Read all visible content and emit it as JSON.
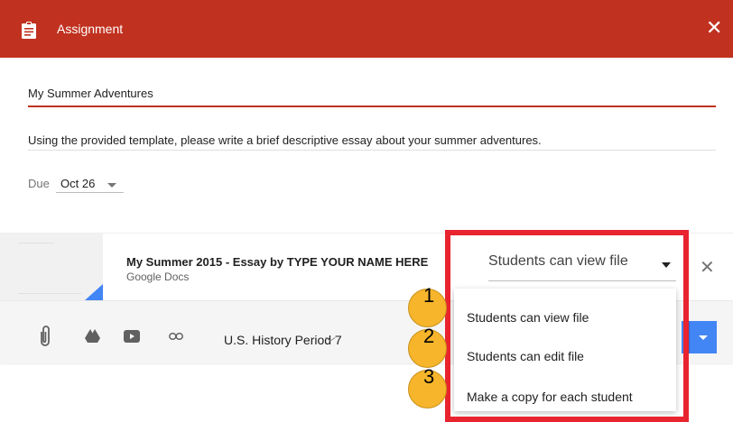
{
  "header": {
    "title": "Assignment",
    "icon": "assignment-icon",
    "close_icon": "close-icon",
    "color": "#c1311f"
  },
  "assignment": {
    "title_value": "My Summer Adventures",
    "instructions_value": "Using the provided template, please write a brief descriptive essay about your summer adventures.",
    "due_label": "Due",
    "due_value": "Oct 26"
  },
  "attachment": {
    "file_name": "My Summer 2015 - Essay by TYPE YOUR NAME HERE",
    "file_type": "Google Docs",
    "permission_selected": "Students can view file",
    "remove_icon": "close-icon"
  },
  "footer": {
    "icons": [
      "paperclip-icon",
      "google-drive-icon",
      "youtube-icon",
      "link-icon"
    ],
    "class_value": "U.S. History Period 7",
    "accent": "#4285f4"
  },
  "permission_menu": {
    "options": [
      "Students can view file",
      "Students can edit file",
      "Make a copy for each student"
    ]
  },
  "annotations": {
    "badges": [
      "1",
      "2",
      "3"
    ],
    "highlight_color": "#e8242f",
    "badge_color": "#f7b52b"
  }
}
